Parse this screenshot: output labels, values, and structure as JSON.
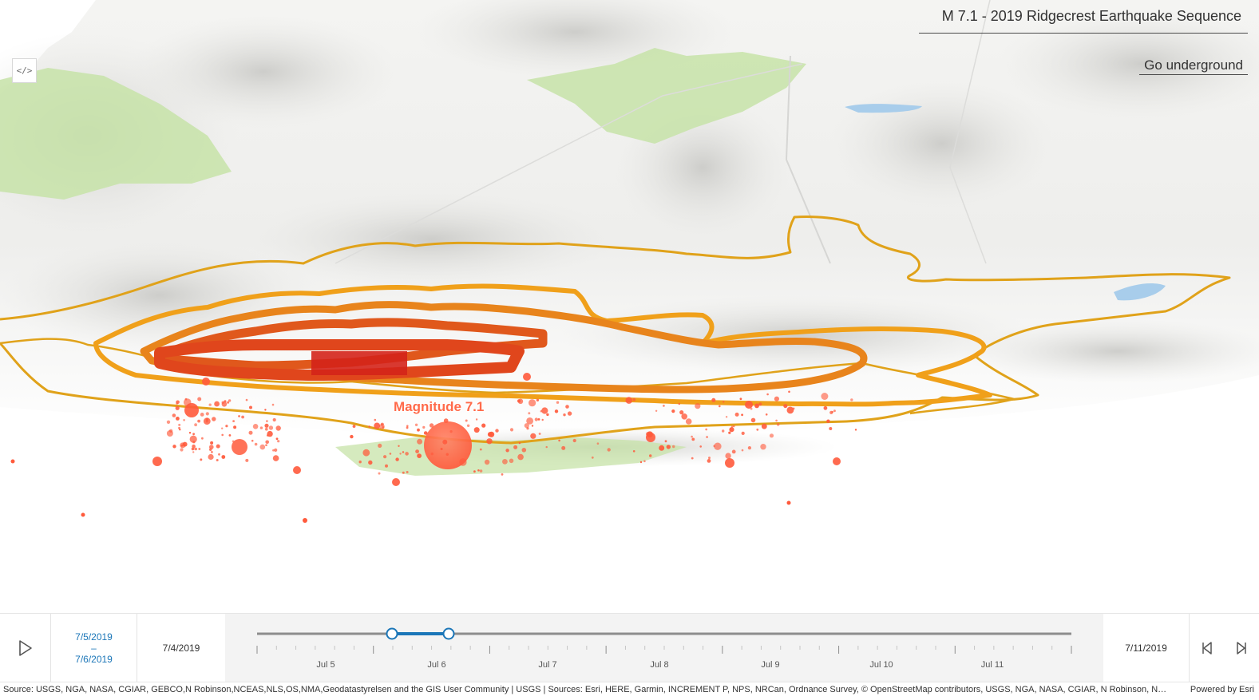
{
  "title": "M 7.1 - 2019 Ridgecrest Earthquake Sequence",
  "underground_label": "Go underground",
  "embed_icon": "</>",
  "map_label": "Magnitude 7.1",
  "slider": {
    "range_start": "7/5/2019",
    "range_sep": "–",
    "range_end": "7/6/2019",
    "min_label": "7/4/2019",
    "max_label": "7/11/2019",
    "ticks": [
      "Jul 5",
      "Jul 6",
      "Jul 7",
      "Jul 8",
      "Jul 9",
      "Jul 10",
      "Jul 11"
    ],
    "thumb_start": "7/5/2019",
    "thumb_end": "7/6/2019"
  },
  "attribution": "Source: USGS, NGA, NASA, CGIAR, GEBCO,N Robinson,NCEAS,NLS,OS,NMA,Geodatastyrelsen and the GIS User Community | USGS | Sources: Esri, HERE, Garmin, INCREMENT P, NPS, NRCan, Ordnance Survey, © OpenStreetMap contributors, USGS, NGA, NASA, CGIAR, N Robinson, NCEAS, NLS, OS, NMA, Geodatastyrelsen, Rijkswaterstaat, GSA, Geoland, FEMA, Intermap and the GIS user community",
  "powered_by": "Powered by Esri",
  "colors": {
    "accent": "#1b76b8",
    "quake": "#ff5a3c",
    "contour_outer": "#e0a21a",
    "contour_mid": "#e8841c",
    "contour_inner": "#e0461c",
    "contour_core": "#d4231a",
    "park": "#c7e3a8"
  },
  "icons": [
    "play-icon",
    "code-icon",
    "step-back-icon",
    "step-forward-icon"
  ]
}
